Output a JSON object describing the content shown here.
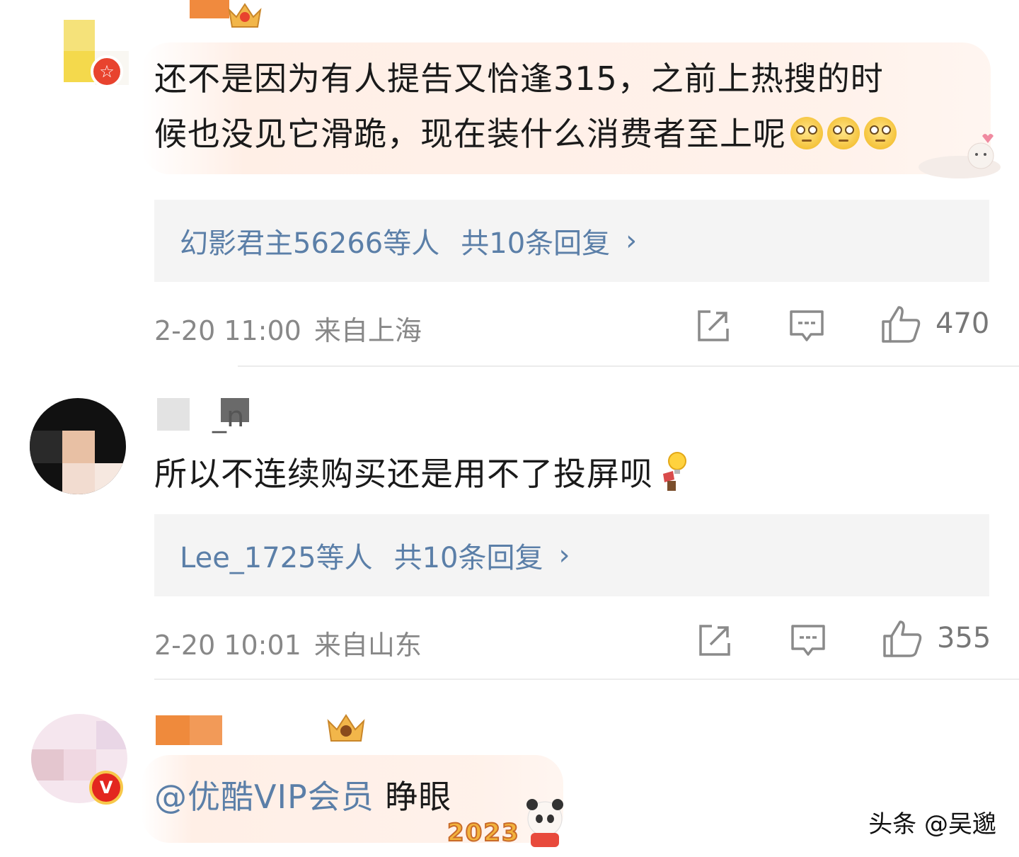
{
  "comments": [
    {
      "text_line1": "还不是因为有人提告又恰逢315，之前上热搜的时",
      "text_line2": "候也没见它滑跪，现在装什么消费者至上呢",
      "emoji_name": "eye-roll-emoji",
      "reply": {
        "who": "幻影君主56266等人",
        "count": "共10条回复",
        "chevron": "›"
      },
      "time": "2-20 11:00",
      "location": "来自上海",
      "likes": "470"
    },
    {
      "username": "_n",
      "text": "所以不连续购买还是用不了投屏呗",
      "reply": {
        "who": "Lee_1725等人",
        "count": "共10条回复",
        "chevron": "›"
      },
      "time": "2-20 10:01",
      "location": "来自山东",
      "likes": "355"
    },
    {
      "mention": "@优酷VIP会员",
      "text": " 睁眼",
      "badge": "V"
    }
  ],
  "sticker_text": "2023",
  "watermark": "头条 @吴邈",
  "colors": {
    "link": "#5b7fa8",
    "meta": "#888888",
    "badge": "#e8432e",
    "reply_bg": "#f4f4f4"
  }
}
